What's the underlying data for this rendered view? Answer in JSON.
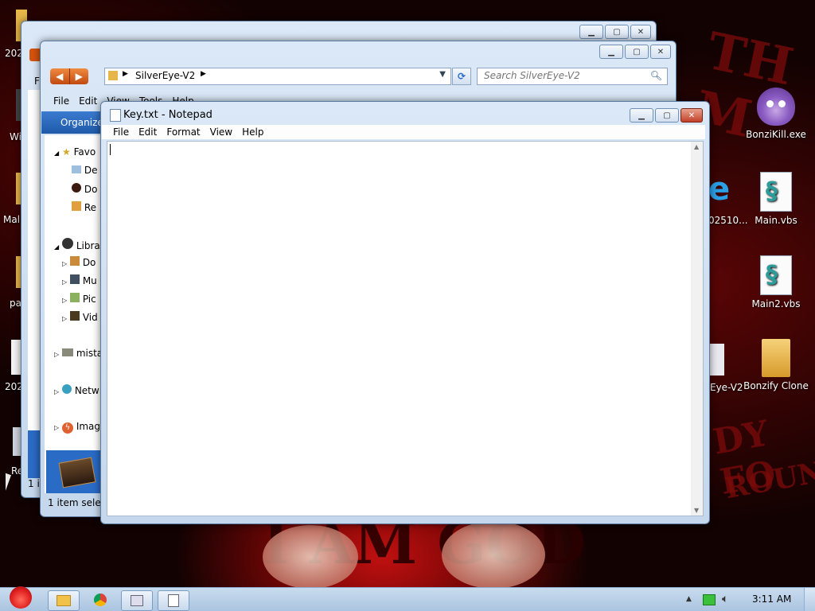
{
  "colors": {
    "accent": "#2a6bc6",
    "close": "#c2412a",
    "wallpaper_red": "#c01010"
  },
  "desktop_left": [
    "202",
    "Wi",
    "Mal",
    "pa",
    "202",
    "Re"
  ],
  "desktop_right": [
    {
      "label": "BonziKill.exe",
      "icon": "bonzi-purple-gorilla-icon"
    },
    {
      "label": "Main.vbs",
      "icon": "vbs-script-icon"
    },
    {
      "label": "Main2.vbs",
      "icon": "vbs-script-icon"
    },
    {
      "label": "Bonzify Clone",
      "icon": "folder-icon"
    }
  ],
  "desktop_partial": {
    "ie_label": "02510...",
    "silvereye_label": "Eye-V2"
  },
  "explorer_front": {
    "address": "SilverEye-V2",
    "search_placeholder": "Search SilverEye-V2",
    "menu": [
      "File",
      "Edit",
      "View",
      "Tools",
      "Help"
    ],
    "organize": "Organize",
    "nav": {
      "favorites": "Favo",
      "fav_items": [
        "De",
        "Do",
        "Re"
      ],
      "libraries": "Libra",
      "lib_items": [
        "Do",
        "Mu",
        "Pic",
        "Vid"
      ],
      "homegroup": "mista",
      "network": "Netw",
      "image": "Imag"
    },
    "status": "1 item selec"
  },
  "explorer_back": {
    "menu_first": "F",
    "status": "1 it"
  },
  "notepad": {
    "title": "Key.txt - Notepad",
    "menu": [
      "File",
      "Edit",
      "Format",
      "View",
      "Help"
    ],
    "content": ""
  },
  "taskbar": {
    "time": "3:11 AM"
  }
}
